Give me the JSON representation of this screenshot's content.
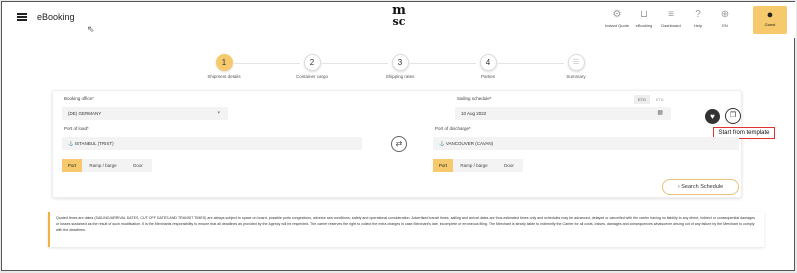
{
  "header": {
    "app_title": "eBooking",
    "logo_top": "m",
    "logo_bottom": "sc",
    "items": [
      {
        "label": "Instant Quote",
        "icon": "instant-quote-icon",
        "glyph": "⚙"
      },
      {
        "label": "eBooking",
        "icon": "cart-icon",
        "glyph": "🛒"
      },
      {
        "label": "Dashboard",
        "icon": "dashboard-icon",
        "glyph": "☰"
      },
      {
        "label": "Help",
        "icon": "help-icon",
        "glyph": "?"
      },
      {
        "label": "EN",
        "icon": "globe-icon",
        "glyph": "⊕"
      }
    ],
    "guest_label": "Guest"
  },
  "stepper": [
    {
      "number": "1",
      "label": "Shipment details",
      "active": true
    },
    {
      "number": "2",
      "label": "Container cargo",
      "active": false
    },
    {
      "number": "3",
      "label": "Shipping rates",
      "active": false
    },
    {
      "number": "4",
      "label": "Parties",
      "active": false
    },
    {
      "number": "☰",
      "label": "Summary",
      "active": false
    }
  ],
  "form": {
    "booking_office_label": "Booking office*",
    "booking_office_value": "(DE) GERMANY",
    "sailing_schedule_label": "Sailing schedule*",
    "sailing_schedule_value": "10 Aug 2022",
    "toggle_etd": "ETD",
    "toggle_eta": "ETA",
    "port_of_load_label": "Port of load*",
    "port_of_load_value": "ISTANBUL (TRIST)",
    "port_of_discharge_label": "Port of discharge*",
    "port_of_discharge_value": "VANCOUVER (CAVAN)",
    "load_options": [
      "Port",
      "Ramp / barge",
      "Door"
    ],
    "discharge_options": [
      "Port",
      "Ramp / barge",
      "Door"
    ],
    "search_button": "Search Schedule"
  },
  "tooltip": "Start from template",
  "notice": "Quoted times are dates (SAILING/ARRIVAL DATES, CUT OFF DATES AND TRANSIT TIMES) are always subject to space on board, possible ports congestions, adverse sea conditions, safety and operational consideration. Advertised transit times, sailing and arrival dates are thus estimated times only and schedules may be advanced, delayed or cancelled with the carrier having no liability to any direct, indirect or consequential damages or losses sustained as the result of such modification. It is the Merchants responsibility to ensure that all deadlines as provided by the Agency will be respected. The carrier reserves the right to collect the extra charges in case Merchant's late, incomplete or erroneous filing. The Merchant is strictly liable to indemnify the Carrier for all costs, losses, damages and consequences whatsoever arising out of any failure by the Merchant to comply with the deadlines.",
  "colors": {
    "accent": "#f5c96c",
    "tooltip_border": "#dd3333"
  }
}
